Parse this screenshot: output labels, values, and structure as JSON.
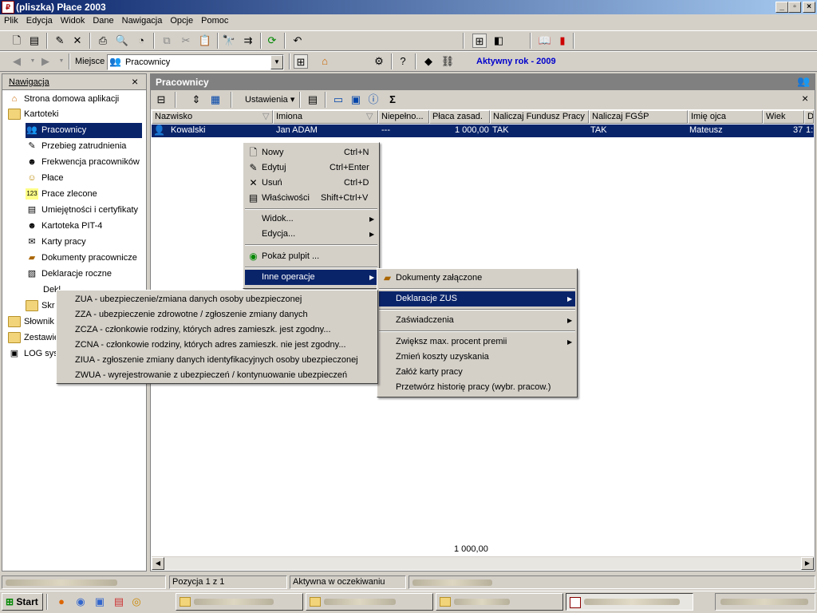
{
  "window": {
    "title": "(pliszka)  Płace 2003",
    "app_icon": "app-logo-icon",
    "caption_buttons": [
      "_",
      "▫",
      "×"
    ]
  },
  "menubar": [
    "Plik",
    "Edycja",
    "Widok",
    "Dane",
    "Nawigacja",
    "Opcje",
    "Pomoc"
  ],
  "address_bar": {
    "label": "Miejsce",
    "value": "Pracownicy",
    "active_year": "Aktywny rok - 2009",
    "active_year_color": "#0000cc"
  },
  "nav": {
    "header": "Nawigacja",
    "close": "×",
    "items": [
      {
        "label": "Strona domowa aplikacji",
        "icon": "home-icon"
      },
      {
        "label": "Kartoteki",
        "icon": "folder-open-icon"
      },
      {
        "label": "Pracownicy",
        "icon": "employees-icon"
      },
      {
        "label": "Przebieg zatrudnienia",
        "icon": "employment-history-icon"
      },
      {
        "label": "Frekwencja pracowników",
        "icon": "attendance-icon"
      },
      {
        "label": "Płace",
        "icon": "payroll-icon"
      },
      {
        "label": "Prace zlecone",
        "icon": "contracts-icon"
      },
      {
        "label": "Umiejętności i certyfikaty",
        "icon": "certificates-icon"
      },
      {
        "label": "Kartoteka PIT-4",
        "icon": "pit4-icon"
      },
      {
        "label": "Karty pracy",
        "icon": "work-cards-icon"
      },
      {
        "label": "Dokumenty pracownicze",
        "icon": "documents-icon"
      },
      {
        "label": "Deklaracje roczne",
        "icon": "annual-declarations-icon"
      },
      {
        "label": "Dekl",
        "icon": ""
      },
      {
        "label": "Skr",
        "icon": "folder-icon"
      },
      {
        "label": "Słownik",
        "icon": "folder-icon"
      },
      {
        "label": "Zestawie",
        "icon": "folder-icon"
      },
      {
        "label": "LOG sys",
        "icon": "log-icon"
      }
    ]
  },
  "main": {
    "title": "Pracownicy",
    "settings_label": "Ustawienia",
    "sigma": "Σ",
    "close": "×",
    "columns": [
      "Nazwisko",
      "Imiona",
      "Niepełno...",
      "Płaca zasad.",
      "Naliczaj Fundusz Pracy",
      "Naliczaj FGŚP",
      "Imię ojca",
      "Wiek",
      "D"
    ],
    "row": {
      "nazwisko": "Kowalski",
      "imiona": "Jan ADAM",
      "niepelno": "---",
      "placa": "1 000,00",
      "fp": "TAK",
      "fgsp": "TAK",
      "imie_ojca": "Mateusz",
      "wiek": "37",
      "d": "1:"
    },
    "total": "1 000,00"
  },
  "context_menu": {
    "items": [
      {
        "label": "Nowy",
        "shortcut": "Ctrl+N",
        "icon": "new-doc-icon"
      },
      {
        "label": "Edytuj",
        "shortcut": "Ctrl+Enter",
        "icon": "edit-icon"
      },
      {
        "label": "Usuń",
        "shortcut": "Ctrl+D",
        "icon": "delete-icon"
      },
      {
        "label": "Właściwości",
        "shortcut": "Shift+Ctrl+V",
        "icon": "properties-icon"
      },
      {
        "label": "Widok...",
        "shortcut": "",
        "icon": ""
      },
      {
        "label": "Edycja...",
        "shortcut": "",
        "icon": ""
      },
      {
        "label": "Pokaż pulpit ...",
        "shortcut": "",
        "icon": "desktop-icon"
      },
      {
        "label": "Inne operacje",
        "shortcut": "",
        "icon": ""
      }
    ]
  },
  "submenu_inne": {
    "items": [
      {
        "label": "Dokumenty załączone",
        "icon": "attachment-icon"
      },
      {
        "label": "Deklaracje ZUS"
      },
      {
        "label": "Zaświadczenia"
      },
      {
        "label": "Zwiększ max. procent premii"
      },
      {
        "label": "Zmień koszty uzyskania"
      },
      {
        "label": "Załóż karty pracy"
      },
      {
        "label": "Przetwórz historię pracy (wybr. pracow.)"
      }
    ]
  },
  "submenu_zus": {
    "items": [
      "ZUA - ubezpieczenie/zmiana danych osoby ubezpieczonej",
      "ZZA - ubezpieczenie zdrowotne / zgłoszenie zmiany danych",
      "ZCZA - członkowie rodziny, których adres zamieszk. jest zgodny...",
      "ZCNA - członkowie rodziny, których adres zamieszk. nie jest zgodny...",
      "ZIUA - zgłoszenie zmiany danych identyfikacyjnych osoby ubezpieczonej",
      "ZWUA - wyrejestrowanie z ubezpieczeń / kontynuowanie ubezpieczeń"
    ]
  },
  "statusbar": {
    "position": "Pozycja 1 z 1",
    "state": "Aktywna w oczekiwaniu"
  },
  "taskbar": {
    "start": "Start"
  },
  "colors": {
    "selection": "#0a246a",
    "face": "#d4d0c8",
    "title_start": "#0a246a",
    "title_end": "#a6caf0"
  }
}
